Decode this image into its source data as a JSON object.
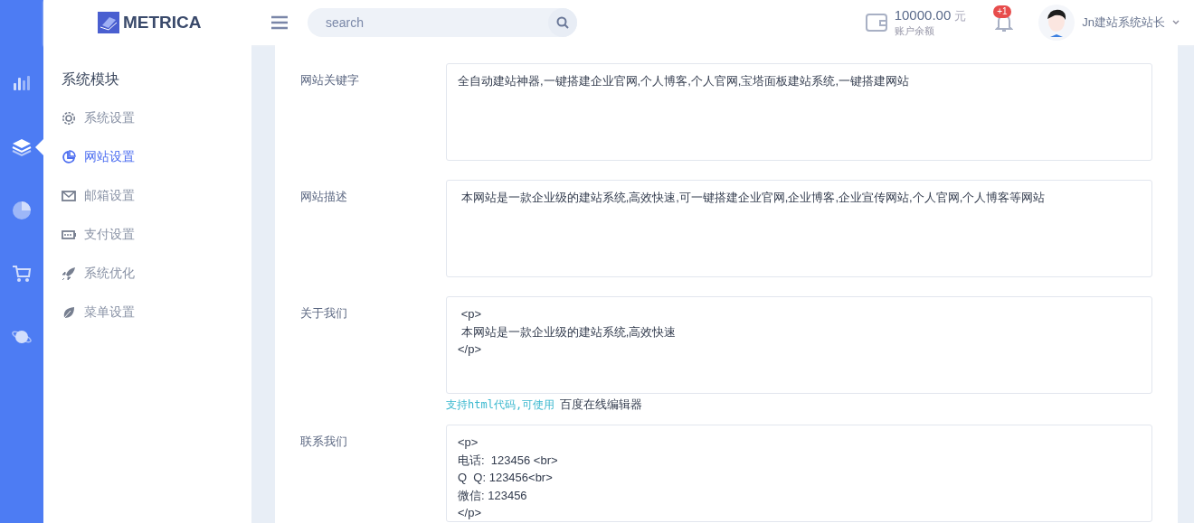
{
  "header": {
    "logo": "METRICA",
    "search": {
      "placeholder": "search"
    },
    "balance": {
      "amount": "10000.00",
      "unit": "元",
      "label": "账户余额"
    },
    "notifications": {
      "badge": "+1"
    },
    "user": {
      "name": "Jn建站系统站长"
    }
  },
  "rail": [
    {
      "selected": false
    },
    {
      "selected": true
    },
    {
      "selected": false
    },
    {
      "selected": false
    },
    {
      "selected": false
    }
  ],
  "sidebar": {
    "title": "系统模块",
    "items": [
      {
        "label": "系统设置",
        "selected": false
      },
      {
        "label": "网站设置",
        "selected": true
      },
      {
        "label": "邮箱设置",
        "selected": false
      },
      {
        "label": "支付设置",
        "selected": false
      },
      {
        "label": "系统优化",
        "selected": false
      },
      {
        "label": "菜单设置",
        "selected": false
      }
    ]
  },
  "form": [
    {
      "label": "网站关键字",
      "value": "全自动建站神器,一键搭建企业官网,个人博客,个人官网,宝塔面板建站系统,一键搭建网站"
    },
    {
      "label": "网站描述",
      "value": " 本网站是一款企业级的建站系统,高效快速,可一键搭建企业官网,企业博客,企业宣传网站,个人官网,个人博客等网站"
    },
    {
      "label": "关于我们",
      "value": " <p>\n 本网站是一款企业级的建站系统,高效快速\n</p>",
      "help": "支持html代码,可使用",
      "help_link": "百度在线编辑器"
    },
    {
      "label": "联系我们",
      "value": "<p>\n电话:  123456 <br>\nQ  Q: 123456<br>\n微信: 123456\n</p>"
    }
  ]
}
